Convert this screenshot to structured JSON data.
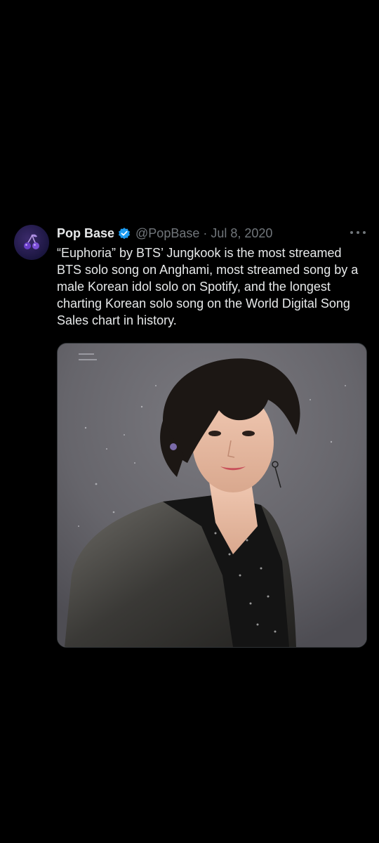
{
  "tweet": {
    "display_name": "Pop Base",
    "verified_icon": "verified-badge-icon",
    "handle": "@PopBase",
    "separator": "·",
    "date": "Jul 8, 2020",
    "more_icon": "more-options-icon",
    "text": "“Euphoria” by BTS’ Jungkook is the most streamed BTS solo song on Anghami, most streamed song by a male Korean idol solo on Spotify, and the longest charting Korean solo song on the World Digital Song Sales chart in history.",
    "avatar_icon": "cherry-logo-icon",
    "media": {
      "description_icon": "photo-image"
    }
  },
  "colors": {
    "background": "#000000",
    "text_primary": "#e7e9ea",
    "text_secondary": "#71767b",
    "verified_blue": "#1d9bf0"
  }
}
